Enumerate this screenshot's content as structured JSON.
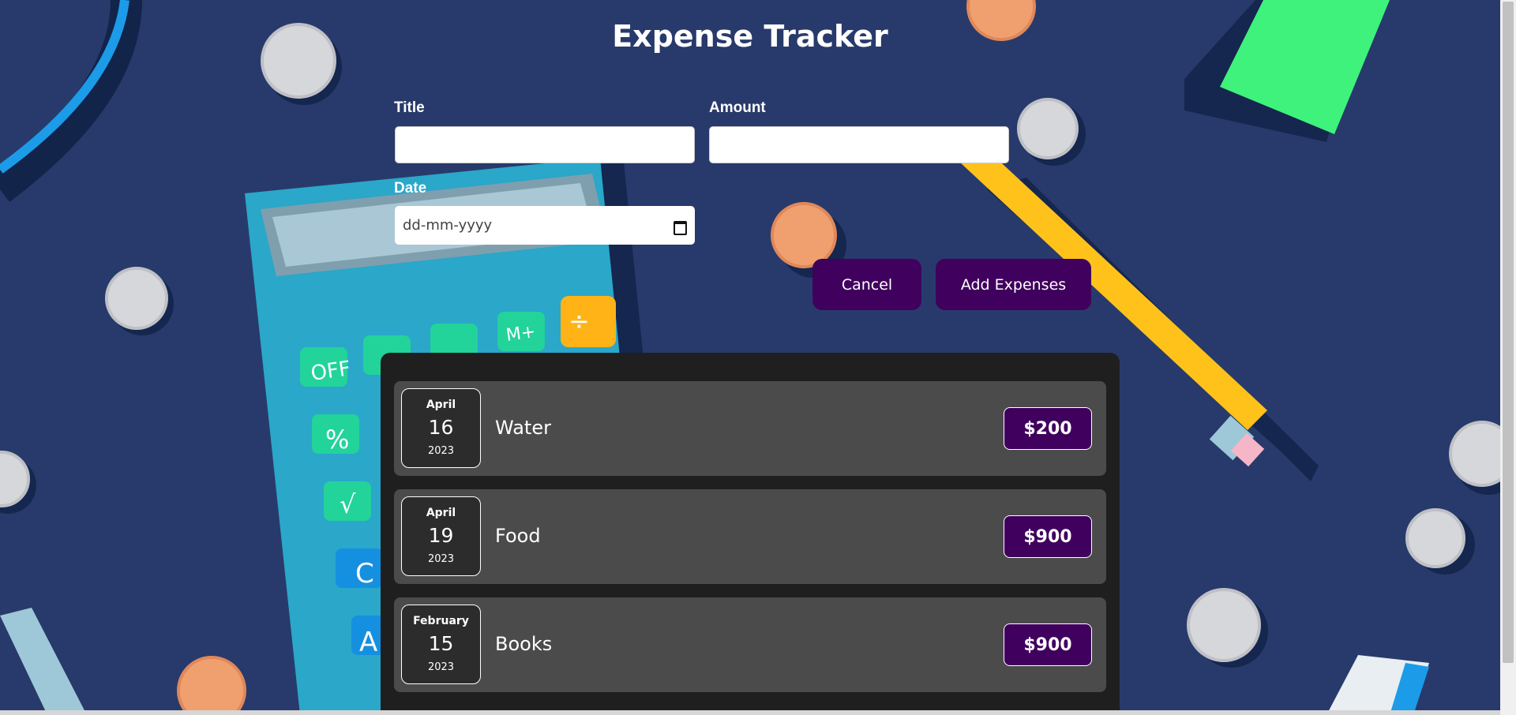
{
  "app": {
    "title": "Expense Tracker"
  },
  "form": {
    "title_label": "Title",
    "title_value": "",
    "amount_label": "Amount",
    "amount_value": "",
    "date_label": "Date",
    "date_placeholder": "dd-mm-yyyy",
    "cancel_label": "Cancel",
    "add_label": "Add Expenses"
  },
  "expenses": [
    {
      "month": "April",
      "day": "16",
      "year": "2023",
      "title": "Water",
      "amount": "$200"
    },
    {
      "month": "April",
      "day": "19",
      "year": "2023",
      "title": "Food",
      "amount": "$900"
    },
    {
      "month": "February",
      "day": "15",
      "year": "2023",
      "title": "Books",
      "amount": "$900"
    }
  ],
  "theme": {
    "background": "#283a6b",
    "button": "#40005d",
    "panel": "#1f1f1f",
    "item": "#4b4b4b"
  }
}
